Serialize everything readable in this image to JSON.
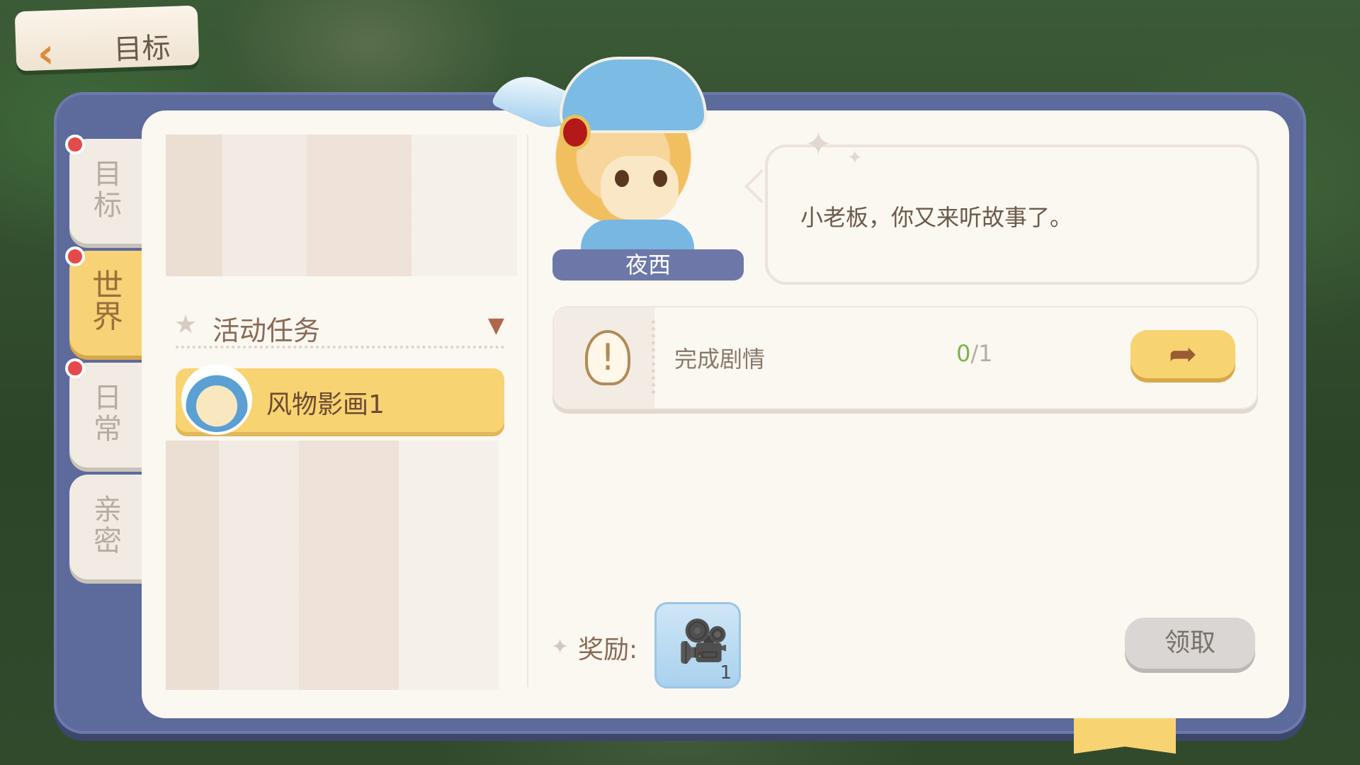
{
  "header": {
    "back_icon": "back-arrow-icon",
    "title": "目标"
  },
  "tabs": [
    {
      "label": "目标",
      "active": false,
      "badge": true
    },
    {
      "label": "世界",
      "active": true,
      "badge": true
    },
    {
      "label": "日常",
      "active": false,
      "badge": true
    },
    {
      "label": "亲密",
      "active": false,
      "badge": false
    }
  ],
  "list": {
    "section_title": "活动任务",
    "section_toggle_icon": "collapse-toggle-icon",
    "selected_quest": "风物影画1"
  },
  "npc": {
    "name": "夜西",
    "dialogue": "小老板，你又来听故事了。"
  },
  "task": {
    "icon": "lightbulb-icon",
    "label": "完成剧情",
    "progress_done": "0",
    "progress_total": "/1",
    "go_icon": "go-arrow-icon"
  },
  "reward": {
    "label": "奖励:",
    "item_icon": "film-camera-icon",
    "quantity": "1",
    "claim_label": "领取"
  },
  "colors": {
    "frame": "#5d6a9c",
    "panel": "#fbf7f1",
    "accent_yellow": "#f8d371",
    "progress_green": "#7ab648",
    "badge_red": "#e54a4a"
  }
}
